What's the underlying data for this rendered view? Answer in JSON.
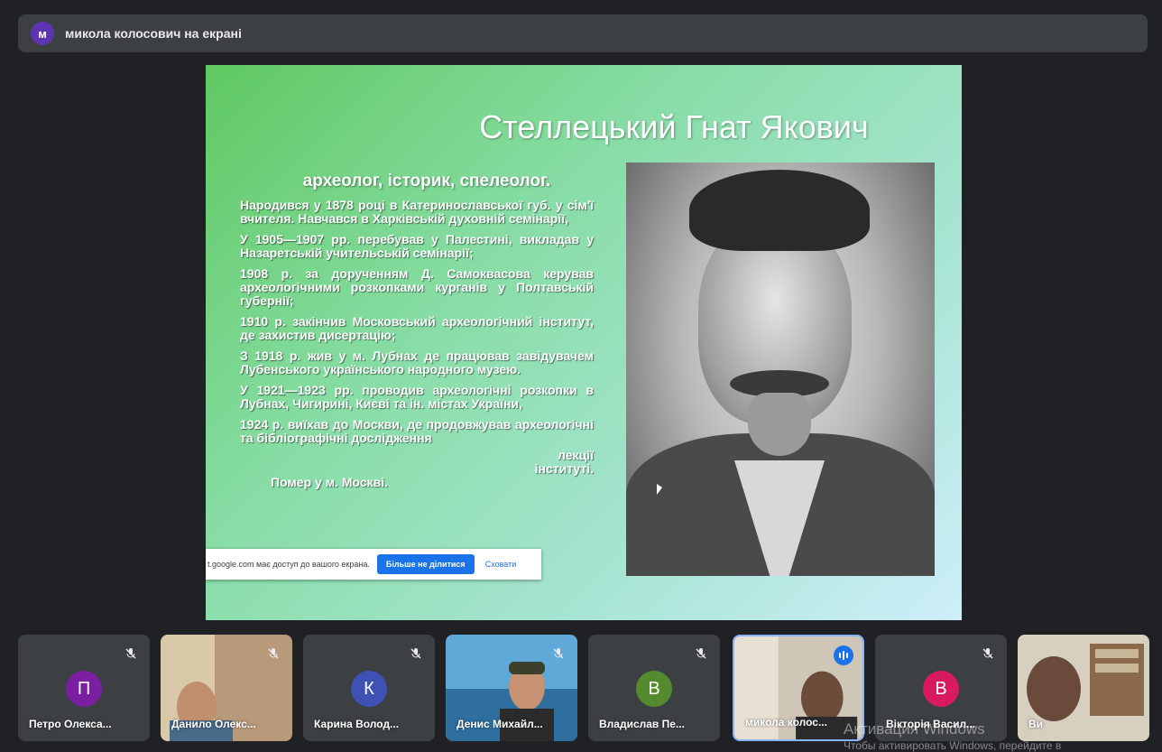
{
  "presenter_bar": {
    "avatar_letter": "м",
    "text": "микола колосович на екрані"
  },
  "slide": {
    "title": "Стеллецький Гнат Якович",
    "subtitle": "археолог, історик, спелеолог.",
    "bio": [
      "Народився у 1878 році в Катеринославської губ. у сім'ї вчителя. Навчався в Харківській духовній семінарії,",
      "У 1905—1907 рр. перебував у Палестині, викладав у Назаретській учительській семінарії;",
      "1908 р. за дорученням Д. Самоквасова керував археологічними розкопками курганів у Полтавській губернії;",
      "1910 р. закінчив Московський археологічний інститут, де захистив дисертацію;",
      "З 1918 р. жив у м. Лубнах де працював завідувачем Лубенського українського народного музею.",
      "У 1921—1923 рр. проводив археологічні розкопки в Лубнах, Чигирині, Києві та ін. містах України,",
      "1924 р. виїхав до Москви, де продовжував археологічні та бібліографічні дослідження"
    ],
    "bio_hidden_tail": "лекції",
    "bio_tail2": "інституті.",
    "bio_last": "Помер у м. Москві."
  },
  "share_notice": {
    "text": "t.google.com має доступ до вашого екрана.",
    "stop_button": "Більше не ділитися",
    "hide_button": "Сховати"
  },
  "participants": [
    {
      "name": "Петро Олекса...",
      "letter": "П",
      "color": "#7b1fa2",
      "muted": true,
      "video": false
    },
    {
      "name": "Данило Олекс...",
      "letter": "",
      "color": "",
      "muted": true,
      "video": true
    },
    {
      "name": "Карина Волод...",
      "letter": "К",
      "color": "#3f51b5",
      "muted": true,
      "video": false
    },
    {
      "name": "Денис Михайл...",
      "letter": "",
      "color": "",
      "muted": true,
      "video": true
    },
    {
      "name": "Владислав Пе...",
      "letter": "В",
      "color": "#558b2f",
      "muted": true,
      "video": false
    },
    {
      "name": "микола колос...",
      "letter": "",
      "color": "",
      "muted": false,
      "video": true,
      "speaking": true
    },
    {
      "name": "Вікторія Васил...",
      "letter": "В",
      "color": "#d81b60",
      "muted": true,
      "video": false
    },
    {
      "name": "Ви",
      "letter": "",
      "color": "",
      "muted": false,
      "video": true
    }
  ],
  "watermark": {
    "line1": "Активация Windows",
    "line2": "Чтобы активировать Windows, перейдите в"
  }
}
